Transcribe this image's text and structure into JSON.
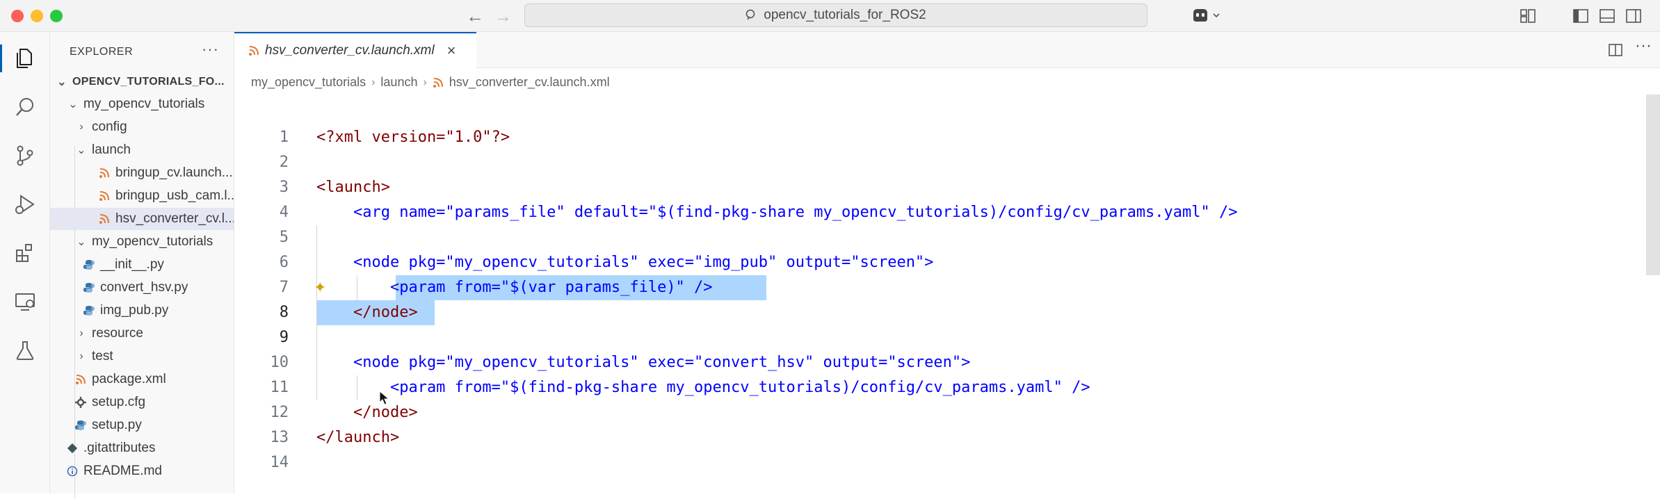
{
  "titlebar": {
    "search_text": "opencv_tutorials_for_ROS2"
  },
  "activity_bar": {
    "icons": [
      "explorer-icon",
      "search-icon",
      "source-control-icon",
      "run-debug-icon",
      "extensions-icon",
      "remote-explorer-icon",
      "testing-icon"
    ]
  },
  "explorer": {
    "header": "EXPLORER",
    "more": "···",
    "items": [
      {
        "label": "OPENCV_TUTORIALS_FO...",
        "type": "root"
      },
      {
        "label": "my_opencv_tutorials",
        "type": "folder-open"
      },
      {
        "label": "config",
        "type": "folder"
      },
      {
        "label": "launch",
        "type": "folder-open"
      },
      {
        "label": "bringup_cv.launch....",
        "type": "xml"
      },
      {
        "label": "bringup_usb_cam.l...",
        "type": "xml"
      },
      {
        "label": "hsv_converter_cv.l...",
        "type": "xml"
      },
      {
        "label": "my_opencv_tutorials",
        "type": "folder-open"
      },
      {
        "label": "__init__.py",
        "type": "py"
      },
      {
        "label": "convert_hsv.py",
        "type": "py"
      },
      {
        "label": "img_pub.py",
        "type": "py"
      },
      {
        "label": "resource",
        "type": "folder"
      },
      {
        "label": "test",
        "type": "folder"
      },
      {
        "label": "package.xml",
        "type": "xml"
      },
      {
        "label": "setup.cfg",
        "type": "gear"
      },
      {
        "label": "setup.py",
        "type": "py"
      },
      {
        "label": ".gitattributes",
        "type": "git"
      },
      {
        "label": "README.md",
        "type": "info"
      }
    ]
  },
  "editor": {
    "tab_label": "hsv_converter_cv.launch.xml",
    "tab_close": "×",
    "breadcrumb": [
      "my_opencv_tutorials",
      "launch",
      "hsv_converter_cv.launch.xml"
    ],
    "line_numbers": [
      "1",
      "2",
      "3",
      "4",
      "5",
      "6",
      "7",
      "8",
      "9",
      "10",
      "11",
      "12",
      "13",
      "14"
    ],
    "lines": [
      "<?xml version=\"1.0\"?>",
      "",
      "<launch>",
      "    <arg name=\"params_file\" default=\"$(find-pkg-share my_opencv_tutorials)/config/cv_params.yaml\" />",
      "",
      "    <node pkg=\"my_opencv_tutorials\" exec=\"img_pub\" output=\"screen\">",
      "        <param from=\"$(var params_file)\" />",
      "    </node>",
      "",
      "    <node pkg=\"my_opencv_tutorials\" exec=\"convert_hsv\" output=\"screen\">",
      "        <param from=\"$(find-pkg-share my_opencv_tutorials)/config/cv_params.yaml\" />",
      "    </node>",
      "</launch>",
      ""
    ]
  },
  "colors": {
    "accent": "#005fb8",
    "selection": "#add6ff",
    "xml_tag": "#800000",
    "xml_attr": "#e50000",
    "xml_string": "#0000ff"
  }
}
